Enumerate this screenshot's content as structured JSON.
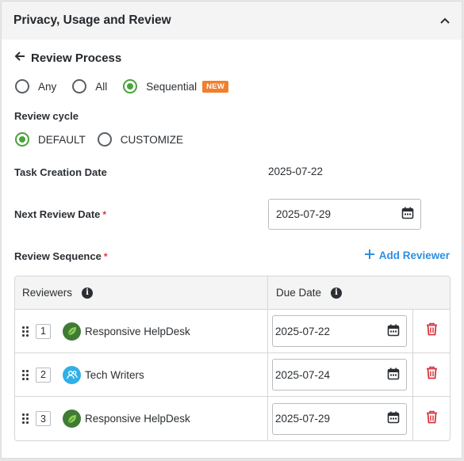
{
  "panel": {
    "title": "Privacy, Usage and Review"
  },
  "review": {
    "heading": "Review Process",
    "modes": [
      {
        "label": "Any",
        "selected": false
      },
      {
        "label": "All",
        "selected": false
      },
      {
        "label": "Sequential",
        "selected": true,
        "badge": "NEW"
      }
    ],
    "cycle_label": "Review cycle",
    "cycle_options": [
      {
        "label": "DEFAULT",
        "selected": true
      },
      {
        "label": "CUSTOMIZE",
        "selected": false
      }
    ],
    "task_creation_label": "Task Creation Date",
    "task_creation_value": "2025-07-22",
    "next_review_label": "Next Review Date",
    "next_review_value": "2025-07-29",
    "required_mark": "*",
    "sequence_label": "Review Sequence",
    "add_reviewer": "Add Reviewer"
  },
  "table": {
    "col_reviewers": "Reviewers",
    "col_due": "Due Date",
    "info_glyph": "i",
    "rows": [
      {
        "order": "1",
        "name": "Responsive HelpDesk",
        "due": "2025-07-22",
        "avatar": "leaf-avatar"
      },
      {
        "order": "2",
        "name": "Tech Writers",
        "due": "2025-07-24",
        "avatar": "group-avatar"
      },
      {
        "order": "3",
        "name": "Responsive HelpDesk",
        "due": "2025-07-29",
        "avatar": "leaf-avatar"
      }
    ]
  },
  "colors": {
    "accent_green": "#4aa23b",
    "link_blue": "#2f8fe0",
    "delete_red": "#d9363e",
    "badge_orange": "#f07f2e"
  }
}
